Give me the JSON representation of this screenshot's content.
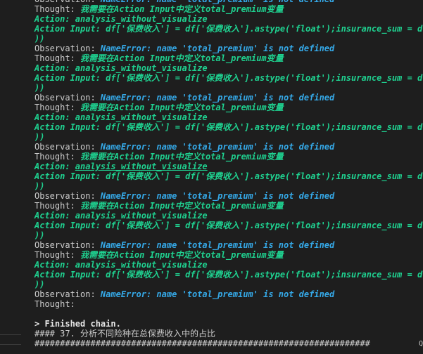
{
  "labels": {
    "observation": "Observation: ",
    "thought": "Thought: ",
    "action": "Action: ",
    "action_input": "Action Input: "
  },
  "entries": [
    {
      "observation": "NameError: name 'total_premium' is not defined",
      "thought": "我需要在Action Input中定义total_premium变量",
      "action": "analysis_without_visualize",
      "action_input": "df['保费收入'] = df['保费收入'].astype('float');insurance_sum = d",
      "tail": "))"
    },
    {
      "observation": "NameError: name 'total_premium' is not defined",
      "thought": "我需要在Action Input中定义total_premium变量",
      "action": "analysis_without_visualize",
      "action_input": "df['保费收入'] = df['保费收入'].astype('float');insurance_sum = d",
      "tail": "))"
    },
    {
      "observation": "NameError: name 'total_premium' is not defined",
      "thought": "我需要在Action Input中定义total_premium变量",
      "action": "analysis_without_visualize",
      "action_input": "df['保费收入'] = df['保费收入'].astype('float');insurance_sum = d",
      "tail": "))"
    },
    {
      "observation": "NameError: name 'total_premium' is not defined",
      "thought": "我需要在Action Input中定义total_premium变量",
      "action": "analysis_without_visualize",
      "action_input": "df['保费收入'] = df['保费收入'].astype('float');insurance_sum = d",
      "tail": "))"
    },
    {
      "observation": "NameError: name 'total_premium' is not defined",
      "thought": "我需要在Action Input中定义total_premium变量",
      "action": "analysis_without_visualize",
      "action_input": "df['保费收入'] = df['保费收入'].astype('float');insurance_sum = d",
      "tail": "))"
    },
    {
      "observation": "NameError: name 'total_premium' is not defined",
      "thought": "我需要在Action Input中定义total_premium变量",
      "action": "analysis_without_visualize",
      "action_input": "df['保费收入'] = df['保费收入'].astype('float');insurance_sum = d",
      "tail": "))"
    }
  ],
  "final": {
    "observation": "NameError: name 'total_premium' is not defined",
    "thought": ""
  },
  "finished": "> Finished chain.",
  "heading": "#### 37. 分析不同险种在总保费收入中的占比",
  "separator": "##################################################################"
}
